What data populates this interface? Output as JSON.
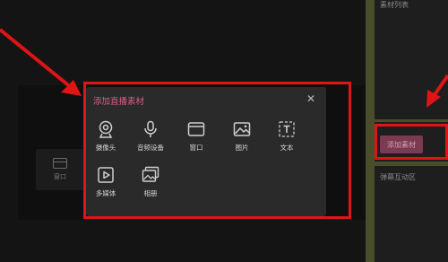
{
  "stage": {
    "ghost_window_label": "窗口"
  },
  "right_panel": {
    "material_list_title": "素材列表",
    "add_material_button": "添加素材",
    "popup_interaction_title": "弹幕互动区"
  },
  "dialog": {
    "title": "添加直播素材",
    "close_glyph": "✕",
    "sources": [
      {
        "label": "摄像头",
        "icon": "camera-icon"
      },
      {
        "label": "音频设备",
        "icon": "microphone-icon"
      },
      {
        "label": "窗口",
        "icon": "window-icon"
      },
      {
        "label": "图片",
        "icon": "image-icon"
      },
      {
        "label": "文本",
        "icon": "text-icon"
      },
      {
        "label": "多媒体",
        "icon": "media-play-icon"
      },
      {
        "label": "相册",
        "icon": "album-icon"
      }
    ]
  },
  "colors": {
    "accent_pink": "#e05a8a",
    "annotation_red": "#e01414",
    "add_button_bg": "#7a3a52",
    "panel_olive": "#4a4d2a"
  }
}
